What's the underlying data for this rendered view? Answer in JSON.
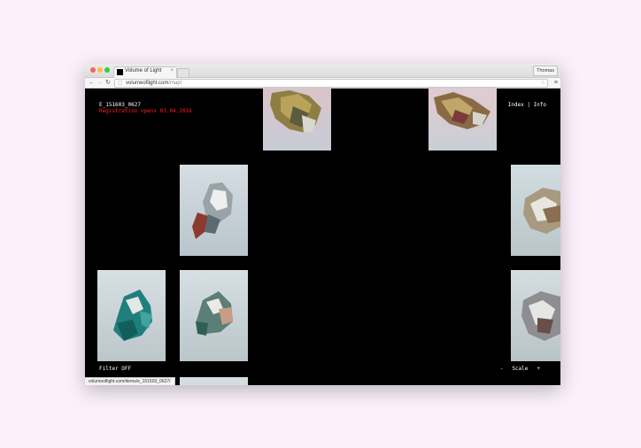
{
  "browser": {
    "tab_title": "Volume of Light",
    "profile": "Thomas",
    "url_host": "volumeoflight.com",
    "url_path": "/map/",
    "status_url": "volumeoflight.com/items/e_151603_0627/"
  },
  "page": {
    "item_id": "E_151603_0627",
    "registration": "Registration opens 03.04.2016",
    "nav_links": "Index | Info",
    "filter": "Filter OFF",
    "scale": {
      "minus": "-",
      "label": "Scale",
      "plus": "+"
    }
  },
  "colors": {
    "background": "#fbf0fb",
    "content_bg": "#000000",
    "registration_red": "#ff1f1f"
  },
  "icons": [
    "back-arrow-icon",
    "forward-arrow-icon",
    "reload-icon",
    "page-icon",
    "star-icon",
    "menu-icon",
    "close-icon"
  ]
}
